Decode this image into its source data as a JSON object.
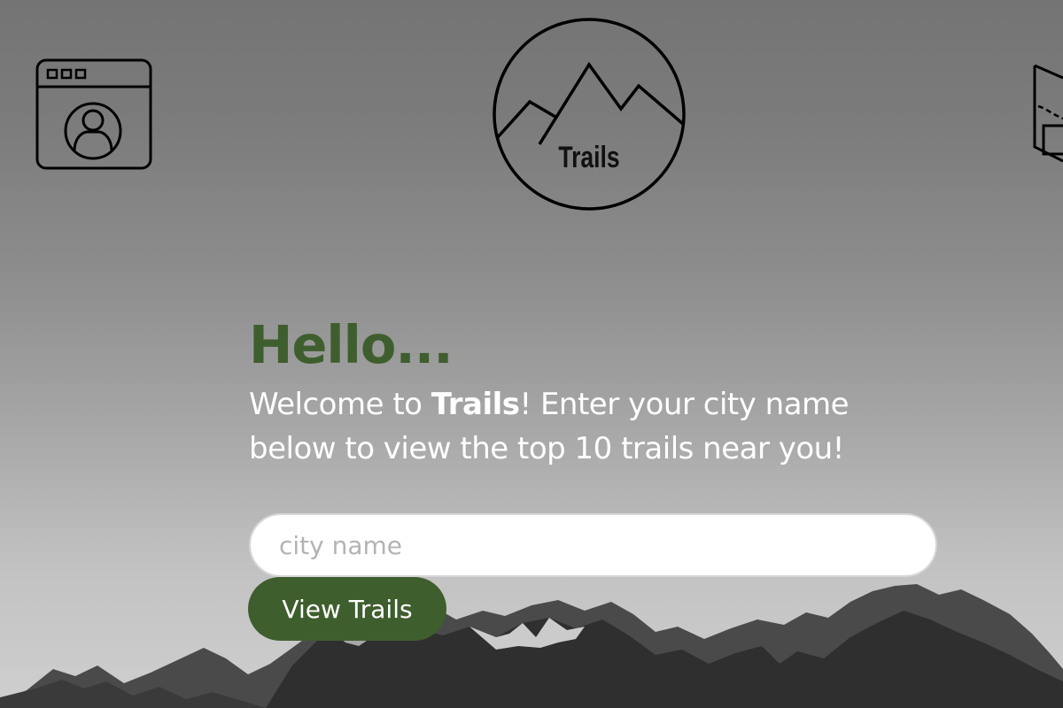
{
  "header": {
    "profile_icon": "browser-profile-icon",
    "logo": {
      "icon": "mountain-logo-icon",
      "text": "Trails"
    },
    "map_icon": "map-icon"
  },
  "main": {
    "greeting": "Hello...",
    "welcome_prefix": "Welcome to ",
    "welcome_brand": "Trails",
    "welcome_suffix": "! Enter your city name below to view the top 10 trails near you!",
    "search": {
      "placeholder": "city name",
      "value": ""
    },
    "button_label": "View Trails"
  },
  "colors": {
    "accent_green": "#3f5e2e",
    "background_gray": "#8e8e8e",
    "input_background": "#ffffff",
    "text_light": "#ffffff"
  }
}
